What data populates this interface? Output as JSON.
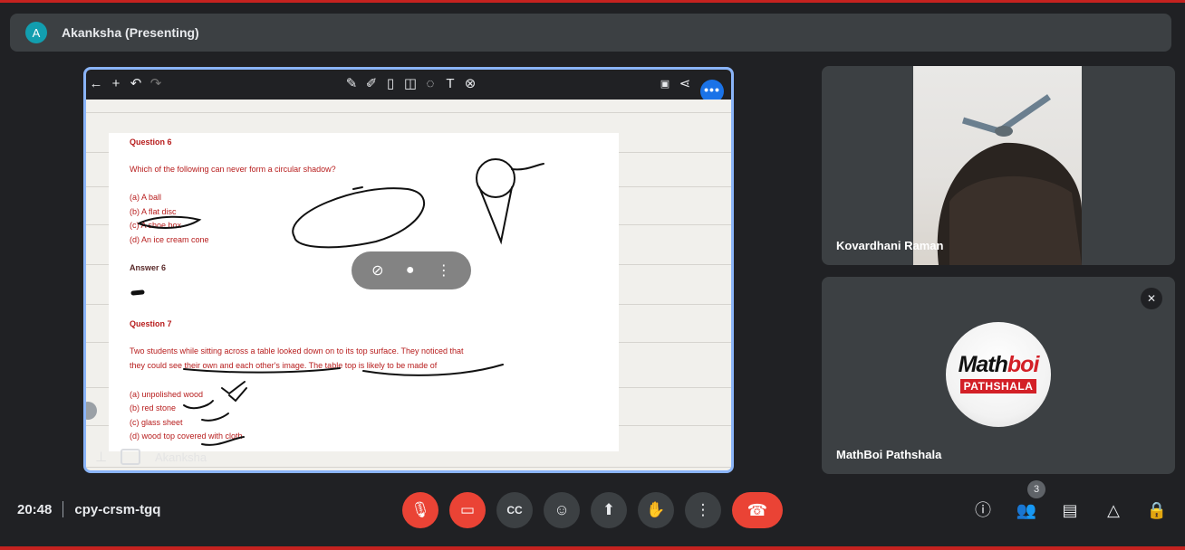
{
  "presenting": {
    "avatar_letter": "A",
    "name": "Akanksha (Presenting)"
  },
  "whiteboard": {
    "question6_title": "Question 6",
    "question6_text": "Which of the following can never form a circular shadow?",
    "question6_options": [
      "(a) A ball",
      "(b) A flat disc",
      "(c) A shoe box",
      "(d) An ice cream cone"
    ],
    "answer6_title": "Answer 6",
    "question7_title": "Question 7",
    "question7_line1": "Two students while sitting across a table looked down on to its top surface. They noticed that",
    "question7_line2": "they could see their own and each other's image. The table top is likely to be made of",
    "question7_options": [
      "(a) unpolished wood",
      "(b) red stone",
      "(c) glass sheet",
      "(d) wood top covered with cloth"
    ],
    "presenter_label": "Akanksha",
    "more_label": "•••"
  },
  "participants": [
    {
      "name": "Kovardhani Raman"
    },
    {
      "name": "MathBoi Pathshala",
      "logo_main_a": "Math",
      "logo_main_b": "boi",
      "logo_sub": "PATHSHALA"
    }
  ],
  "meeting": {
    "time": "20:48",
    "code": "cpy-crsm-tgq",
    "people_count": "3"
  },
  "icons": {
    "accent": "#8ab4f8",
    "danger": "#ea4335"
  }
}
